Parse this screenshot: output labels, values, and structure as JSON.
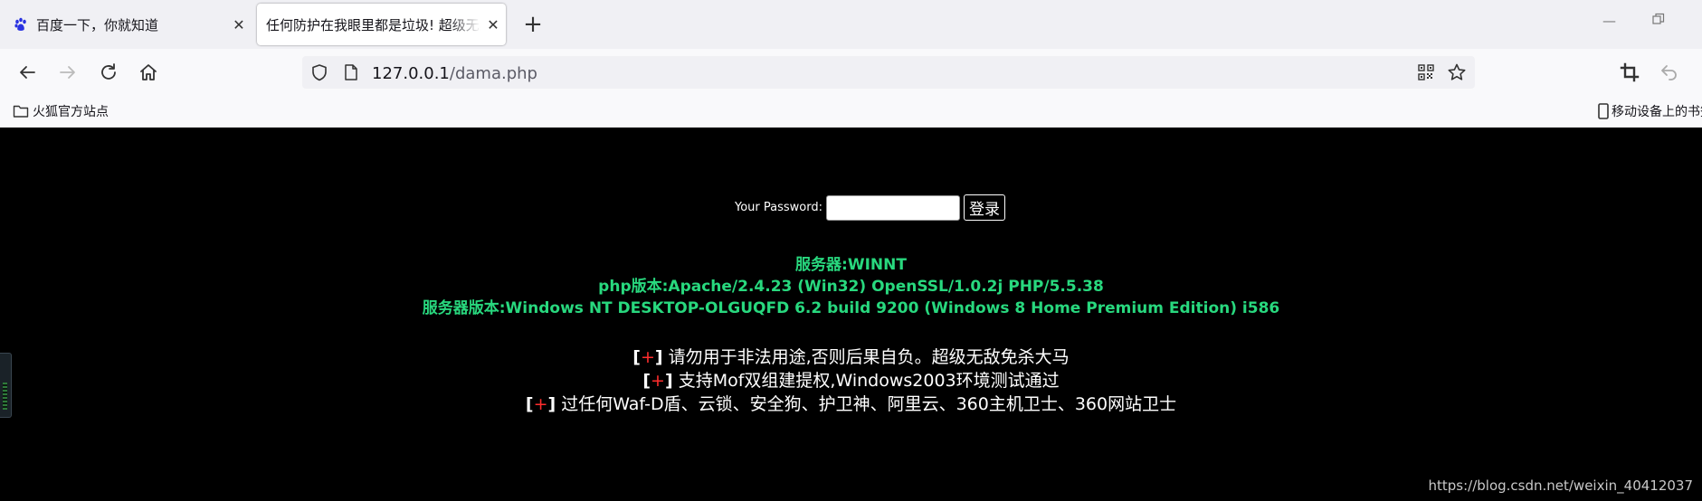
{
  "tabs": [
    {
      "title": "百度一下，你就知道",
      "favicon": "baidu-paw-icon",
      "active": false
    },
    {
      "title": "任何防护在我眼里都是垃圾! 超级无敌",
      "favicon": "none",
      "active": true
    }
  ],
  "nav": {
    "url_host": "127.0.0.1",
    "url_path": "/dama.php"
  },
  "bookmarks": {
    "left": "火狐官方站点",
    "right": "移动设备上的书签"
  },
  "page": {
    "password_label": "Your Password:",
    "password_value": "",
    "login_button": "登录",
    "info_lines": [
      "服务器:WINNT",
      "php版本:Apache/2.4.23 (Win32) OpenSSL/1.0.2j PHP/5.5.38",
      "服务器版本:Windows NT DESKTOP-OLGUQFD 6.2 build 9200 (Windows 8 Home Premium Edition) i586"
    ],
    "bracket_open": "[",
    "bracket_plus": "+",
    "bracket_close": "]",
    "notes": [
      "请勿用于非法用途,否则后果自负。超级无敌免杀大马",
      "支持Mof双组建提权,Windows2003环境测试通过",
      "过任何Waf-D盾、云锁、安全狗、护卫神、阿里云、360主机卫士、360网站卫士"
    ]
  },
  "watermark": "https://blog.csdn.net/weixin_40412037",
  "colors": {
    "page_bg": "#000000",
    "info_text": "#28d87e",
    "plus_sign": "#ff2d2d"
  }
}
